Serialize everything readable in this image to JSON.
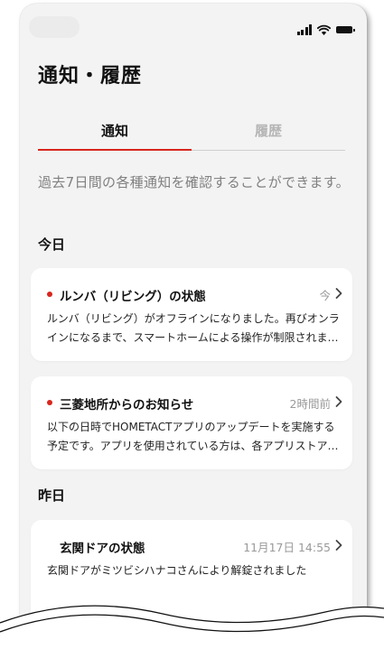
{
  "status_bar": {
    "icons": [
      "signal-icon",
      "wifi-icon",
      "battery-icon"
    ]
  },
  "header": {
    "title": "通知・履歴"
  },
  "tabs": [
    {
      "label": "通知",
      "active": true
    },
    {
      "label": "履歴",
      "active": false
    }
  ],
  "description": "過去7日間の各種通知を確認することができます。",
  "sections": [
    {
      "label": "今日",
      "items": [
        {
          "title": "ルンバ（リビング）の状態",
          "time": "今",
          "body": "ルンバ（リビング）がオフラインになりました。再びオンラインになるまで、スマートホームによる操作が制限されます。",
          "unread": true
        },
        {
          "title": "三菱地所からのお知らせ",
          "time": "2時間前",
          "body": "以下の日時でHOMETACTアプリのアップデートを実施する予定です。アプリを使用されている方は、各アプリストアより更新をお願いします。",
          "unread": true
        }
      ]
    },
    {
      "label": "昨日",
      "items": [
        {
          "title": "玄関ドアの状態",
          "time": "11月17日 14:55",
          "body": "玄関ドアがミツビシハナコさんにより解錠されました",
          "unread": false
        }
      ]
    }
  ],
  "colors": {
    "accent": "#d8261d",
    "background": "#f3f3f3",
    "card": "#ffffff",
    "muted_text": "#808080",
    "inactive_tab": "#b5b5b5"
  }
}
